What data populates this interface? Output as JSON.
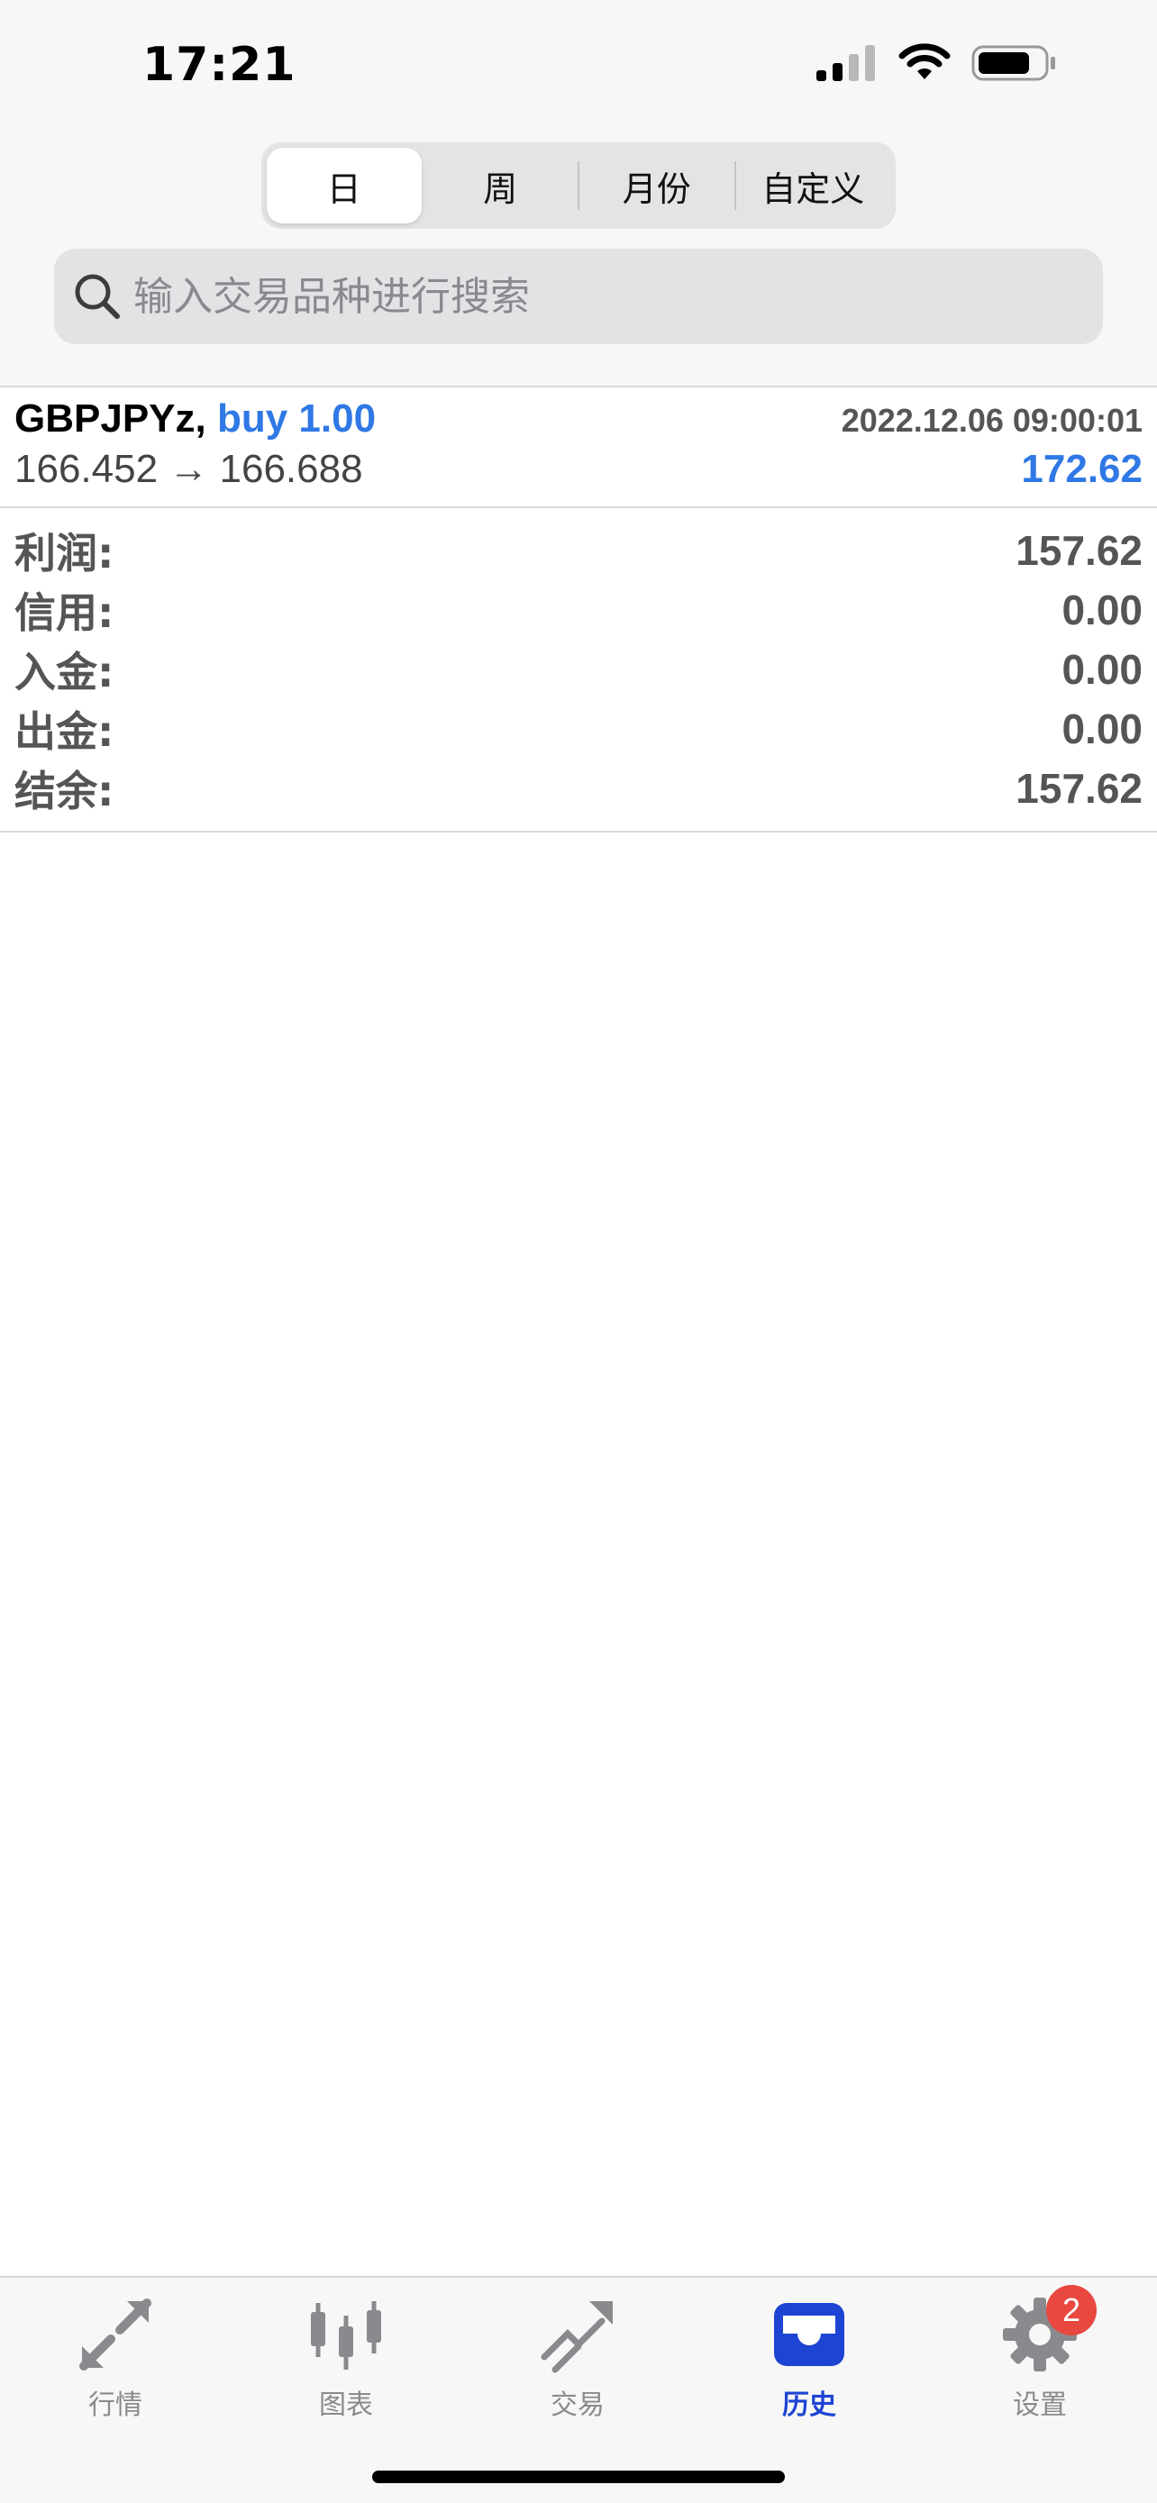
{
  "status_bar": {
    "time": "17:21"
  },
  "period_tabs": [
    {
      "label": "日",
      "active": true
    },
    {
      "label": "周",
      "active": false
    },
    {
      "label": "月份",
      "active": false
    },
    {
      "label": "自定义",
      "active": false
    }
  ],
  "search": {
    "placeholder": "输入交易品种进行搜索",
    "value": ""
  },
  "deal": {
    "symbol": "GBPJPYz,",
    "direction": "buy 1.00",
    "time": "2022.12.06 09:00:01",
    "prices": "166.452 → 166.688",
    "profit": "172.62"
  },
  "summary": [
    {
      "label": "利润:",
      "value": "157.62"
    },
    {
      "label": "信用:",
      "value": "0.00"
    },
    {
      "label": "入金:",
      "value": "0.00"
    },
    {
      "label": "出金:",
      "value": "0.00"
    },
    {
      "label": "结余:",
      "value": "157.62"
    }
  ],
  "tab_bar": [
    {
      "label": "行情",
      "icon": "quotes-icon",
      "active": false
    },
    {
      "label": "图表",
      "icon": "chart-icon",
      "active": false
    },
    {
      "label": "交易",
      "icon": "trade-icon",
      "active": false
    },
    {
      "label": "历史",
      "icon": "history-icon",
      "active": true
    },
    {
      "label": "设置",
      "icon": "settings-icon",
      "active": false,
      "badge": "2"
    }
  ],
  "colors": {
    "accent": "#2f78e5",
    "tab_active": "#1e44d3",
    "badge": "#e8483f"
  }
}
